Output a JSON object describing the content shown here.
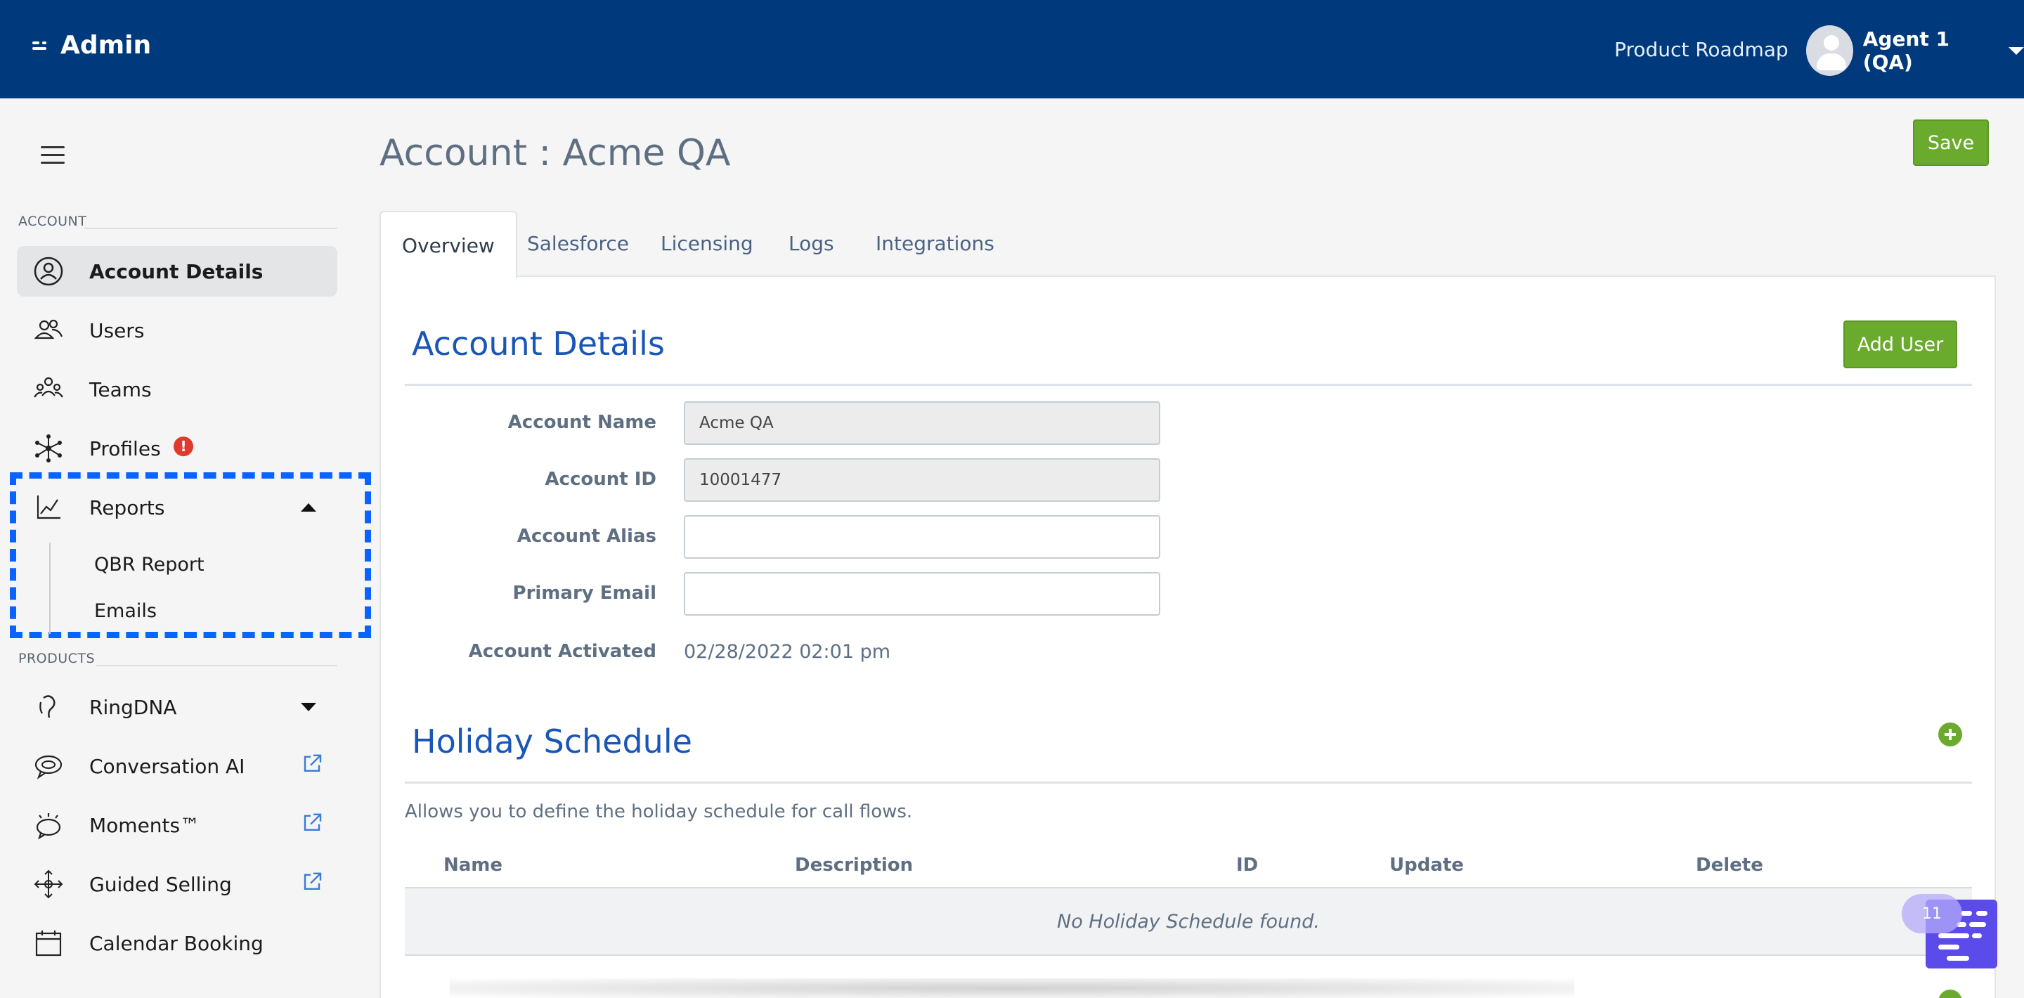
{
  "topbar": {
    "brand": "Admin",
    "product_roadmap": "Product Roadmap",
    "user_name": "Agent 1 (QA)"
  },
  "sidebar": {
    "account_section": "ACCOUNT",
    "products_section": "PRODUCTS",
    "items": {
      "account_details": "Account Details",
      "users": "Users",
      "teams": "Teams",
      "profiles": "Profiles",
      "profiles_badge": "!",
      "reports": "Reports",
      "qbr_report": "QBR Report",
      "emails": "Emails",
      "ringdna": "RingDNA",
      "conversation_ai": "Conversation AI",
      "moments": "Moments™",
      "guided_selling": "Guided Selling",
      "calendar_booking": "Calendar Booking"
    }
  },
  "page": {
    "title": "Account : Acme QA",
    "save_label": "Save"
  },
  "tabs": [
    "Overview",
    "Salesforce",
    "Licensing",
    "Logs",
    "Integrations"
  ],
  "account_details": {
    "title": "Account Details",
    "add_user_label": "Add User",
    "fields": {
      "account_name_label": "Account Name",
      "account_name_value": "Acme QA",
      "account_id_label": "Account ID",
      "account_id_value": "10001477",
      "account_alias_label": "Account Alias",
      "account_alias_value": "",
      "primary_email_label": "Primary Email",
      "primary_email_value": "",
      "account_activated_label": "Account Activated",
      "account_activated_value": "02/28/2022 02:01 pm"
    }
  },
  "holiday_schedule": {
    "title": "Holiday Schedule",
    "description": "Allows you to define the holiday schedule for call flows.",
    "columns": [
      "Name",
      "Description",
      "ID",
      "Update",
      "Delete"
    ],
    "empty_text": "No Holiday Schedule found."
  },
  "widget": {
    "badge": "11"
  },
  "colors": {
    "topbar": "#003a7d",
    "accent_green": "#6aab2e",
    "section_title": "#1a56b6",
    "highlight": "#0a63ff",
    "widget": "#5a4bea"
  }
}
